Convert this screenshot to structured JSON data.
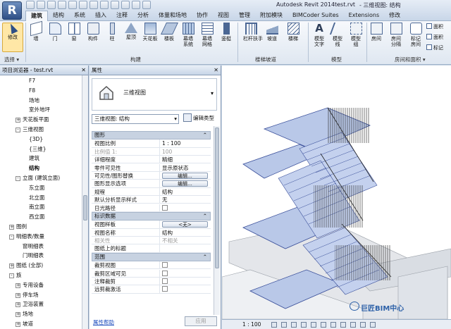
{
  "app": {
    "logo_letter": "R",
    "title": "Autodesk Revit 2014 -",
    "file": "test.rvt",
    "view": "- 三维视图: 结构"
  },
  "tabs": [
    {
      "label": "建筑",
      "active": true
    },
    {
      "label": "结构"
    },
    {
      "label": "系统"
    },
    {
      "label": "插入"
    },
    {
      "label": "注释"
    },
    {
      "label": "分析"
    },
    {
      "label": "体量和场地"
    },
    {
      "label": "协作"
    },
    {
      "label": "视图"
    },
    {
      "label": "管理"
    },
    {
      "label": "附加模块"
    },
    {
      "label": "BIMCoder Suites"
    },
    {
      "label": "Extensions"
    },
    {
      "label": "修改"
    }
  ],
  "ribbon": {
    "modify": "修改",
    "select": "选择 ▾",
    "build_buttons": [
      "墙",
      "门",
      "窗",
      "构件",
      "柱",
      "屋顶",
      "天花板",
      "楼板",
      "幕墙\n系统",
      "幕墙\n网格",
      "竖梃"
    ],
    "build_label": "构建",
    "circ_buttons": [
      "栏杆扶手",
      "坡道",
      "楼梯"
    ],
    "circ_label": "楼梯坡道",
    "model_buttons": [
      "模型\n文字",
      "模型\n线",
      "模型\n组"
    ],
    "model_label": "模型",
    "room_buttons": [
      "房间",
      "房间\n分隔",
      "标记\n房间"
    ],
    "room_small": [
      "面积",
      "面积",
      "标记"
    ],
    "room_label": "房间和面积 ▾"
  },
  "browser": {
    "title": "项目浏览器 - test.rvt",
    "items": [
      {
        "label": "F7",
        "indent": 3
      },
      {
        "label": "F8",
        "indent": 3
      },
      {
        "label": "场地",
        "indent": 3
      },
      {
        "label": "室外地坪",
        "indent": 3
      },
      {
        "label": "天花板平面",
        "indent": 2,
        "toggle": "+"
      },
      {
        "label": "三维视图",
        "indent": 2,
        "toggle": "-"
      },
      {
        "label": "{3D}",
        "indent": 3
      },
      {
        "label": "{三维}",
        "indent": 3
      },
      {
        "label": "建筑",
        "indent": 3
      },
      {
        "label": "结构",
        "indent": 3,
        "bold": true
      },
      {
        "label": "立面 (建筑立面)",
        "indent": 2,
        "toggle": "-"
      },
      {
        "label": "东立面",
        "indent": 3
      },
      {
        "label": "北立面",
        "indent": 3
      },
      {
        "label": "南立面",
        "indent": 3
      },
      {
        "label": "西立面",
        "indent": 3
      },
      {
        "label": "图例",
        "indent": 1,
        "toggle": "+"
      },
      {
        "label": "明细表/数量",
        "indent": 1,
        "toggle": "-"
      },
      {
        "label": "窗明细表",
        "indent": 2
      },
      {
        "label": "门明细表",
        "indent": 2
      },
      {
        "label": "图纸 (全部)",
        "indent": 1,
        "toggle": "+"
      },
      {
        "label": "族",
        "indent": 1,
        "toggle": "-"
      },
      {
        "label": "专用设备",
        "indent": 2,
        "toggle": "+"
      },
      {
        "label": "停车场",
        "indent": 2,
        "toggle": "+"
      },
      {
        "label": "卫浴装置",
        "indent": 2,
        "toggle": "+"
      },
      {
        "label": "场地",
        "indent": 2,
        "toggle": "+"
      },
      {
        "label": "坡道",
        "indent": 2,
        "toggle": "+"
      }
    ]
  },
  "properties": {
    "title": "属性",
    "type_name": "三维视图",
    "view_selector": "三维视图: 结构",
    "edit_type": "编辑类型",
    "sections": [
      {
        "label": "图形",
        "rows": [
          {
            "k": "视图比例",
            "v": "1 : 100"
          },
          {
            "k": "比例值 1:",
            "v": "100",
            "disabled": true
          },
          {
            "k": "详细程度",
            "v": "精细"
          },
          {
            "k": "零件可见性",
            "v": "显示原状态"
          },
          {
            "k": "可见性/图形替换",
            "v": "编辑...",
            "button": true
          },
          {
            "k": "图形显示选项",
            "v": "编辑...",
            "button": true
          },
          {
            "k": "规程",
            "v": "结构"
          },
          {
            "k": "默认分析显示样式",
            "v": "无"
          },
          {
            "k": "日光路径",
            "v": "",
            "checkbox": true
          }
        ]
      },
      {
        "label": "标识数据",
        "rows": [
          {
            "k": "视图样板",
            "v": "<无>",
            "button": true
          },
          {
            "k": "视图名称",
            "v": "结构"
          },
          {
            "k": "相关性",
            "v": "不相关",
            "disabled": true
          },
          {
            "k": "图纸上的标题",
            "v": ""
          }
        ]
      },
      {
        "label": "范围",
        "rows": [
          {
            "k": "裁剪视图",
            "v": "",
            "checkbox": true
          },
          {
            "k": "裁剪区域可见",
            "v": "",
            "checkbox": true
          },
          {
            "k": "注释裁剪",
            "v": "",
            "checkbox": true
          },
          {
            "k": "远剪裁激活",
            "v": "",
            "checkbox": true
          }
        ]
      }
    ],
    "help": "属性帮助",
    "apply": "应用"
  },
  "viewport": {
    "scale": "1 : 100",
    "watermark": "巨匠BIM中心"
  }
}
